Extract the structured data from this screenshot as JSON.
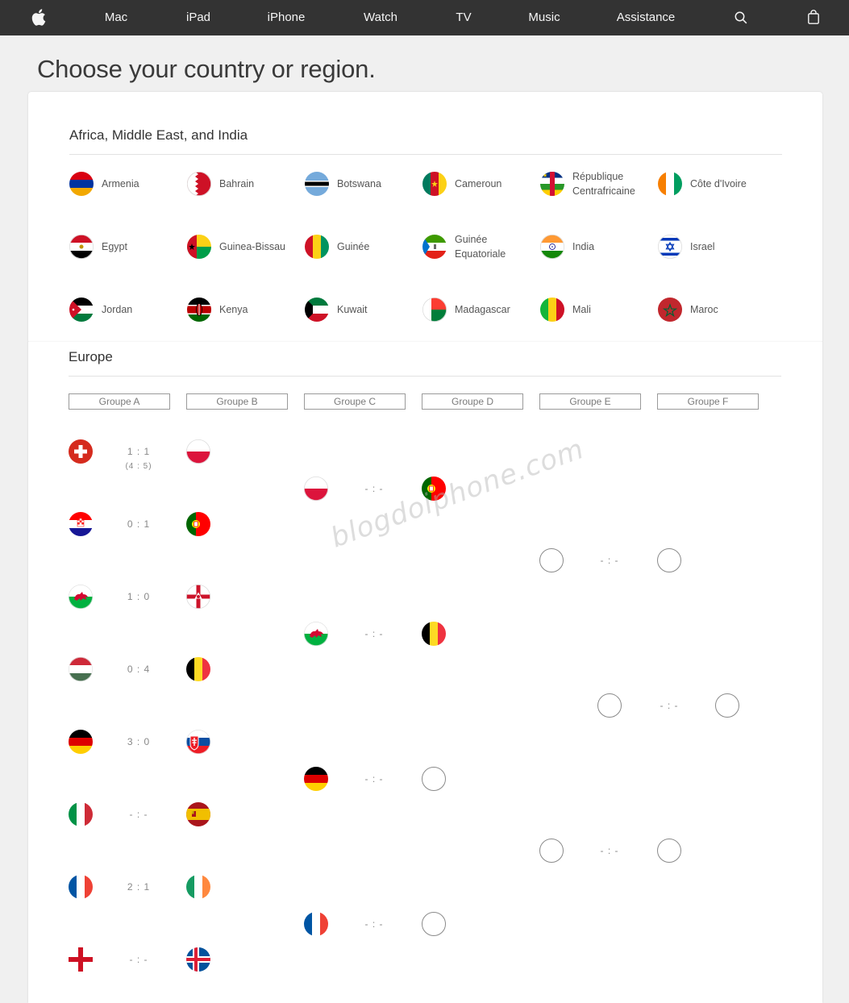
{
  "nav": {
    "items": [
      "Mac",
      "iPad",
      "iPhone",
      "Watch",
      "TV",
      "Music",
      "Assistance"
    ],
    "icons": [
      "apple-logo-icon",
      "search-icon",
      "shopping-bag-icon"
    ]
  },
  "page_title": "Choose your country or region.",
  "section_africa": {
    "title": "Africa, Middle East, and India",
    "countries": [
      {
        "name": "Armenia",
        "flag": "armenia-flag-icon"
      },
      {
        "name": "Bahrain",
        "flag": "bahrain-flag-icon"
      },
      {
        "name": "Botswana",
        "flag": "botswana-flag-icon"
      },
      {
        "name": "Cameroun",
        "flag": "cameroon-flag-icon"
      },
      {
        "name": "République Centrafricaine",
        "flag": "car-flag-icon"
      },
      {
        "name": "Côte d'Ivoire",
        "flag": "ivory-coast-flag-icon"
      },
      {
        "name": "Egypt",
        "flag": "egypt-flag-icon"
      },
      {
        "name": "Guinea-Bissau",
        "flag": "guinea-bissau-flag-icon"
      },
      {
        "name": "Guinée",
        "flag": "guinea-flag-icon"
      },
      {
        "name": "Guinée Equatoriale",
        "flag": "equatorial-guinea-flag-icon"
      },
      {
        "name": "India",
        "flag": "india-flag-icon"
      },
      {
        "name": "Israel",
        "flag": "israel-flag-icon"
      },
      {
        "name": "Jordan",
        "flag": "jordan-flag-icon"
      },
      {
        "name": "Kenya",
        "flag": "kenya-flag-icon"
      },
      {
        "name": "Kuwait",
        "flag": "kuwait-flag-icon"
      },
      {
        "name": "Madagascar",
        "flag": "madagascar-flag-icon"
      },
      {
        "name": "Mali",
        "flag": "mali-flag-icon"
      },
      {
        "name": "Maroc",
        "flag": "morocco-flag-icon"
      }
    ]
  },
  "section_europe": {
    "title": "Europe",
    "groups": [
      "Groupe A",
      "Groupe B",
      "Groupe C",
      "Groupe D",
      "Groupe E",
      "Groupe F"
    ],
    "round_of_16": [
      {
        "home": "switzerland-flag-icon",
        "away": "poland-flag-icon",
        "score": "1 : 1",
        "penalties": "(4 : 5)"
      },
      {
        "home": "croatia-flag-icon",
        "away": "portugal-flag-icon",
        "score": "0 : 1"
      },
      {
        "home": "wales-flag-icon",
        "away": "northern-ireland-flag-icon",
        "score": "1 : 0"
      },
      {
        "home": "hungary-flag-icon",
        "away": "belgium-flag-icon",
        "score": "0 : 4"
      },
      {
        "home": "germany-flag-icon",
        "away": "slovakia-flag-icon",
        "score": "3 : 0"
      },
      {
        "home": "italy-flag-icon",
        "away": "spain-flag-icon",
        "score": "- : -"
      },
      {
        "home": "france-flag-icon",
        "away": "ireland-flag-icon",
        "score": "2 : 1"
      },
      {
        "home": "england-flag-icon",
        "away": "iceland-flag-icon",
        "score": "- : -"
      }
    ],
    "quarter_finals": [
      {
        "home": "poland-flag-icon",
        "away": "portugal-flag-icon",
        "score": "- : -"
      },
      {
        "home": "wales-flag-icon",
        "away": "belgium-flag-icon",
        "score": "- : -"
      },
      {
        "home": "germany-flag-icon",
        "away": "",
        "score": "- : -"
      },
      {
        "home": "france-flag-icon",
        "away": "",
        "score": "- : -"
      }
    ],
    "semi_finals": [
      {
        "home": "",
        "away": "",
        "score": "- : -"
      },
      {
        "home": "",
        "away": "",
        "score": "- : -"
      }
    ],
    "final": {
      "home": "",
      "away": "",
      "score": "- : -"
    }
  },
  "watermark": "blogdoiphone.com"
}
